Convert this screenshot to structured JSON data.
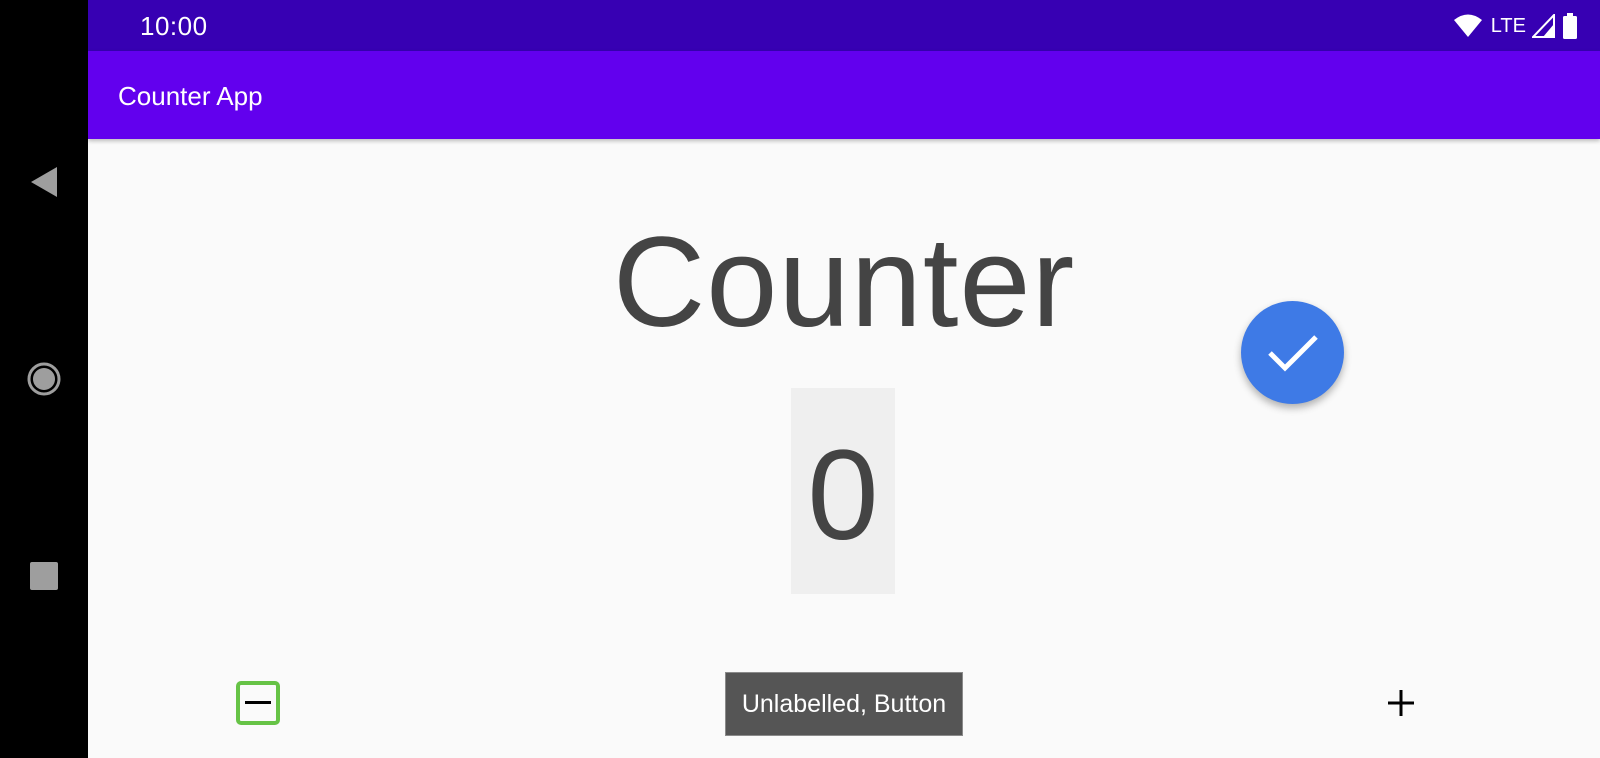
{
  "status_bar": {
    "time": "10:00",
    "network_label": "LTE",
    "icons": [
      "wifi-icon",
      "signal-icon",
      "battery-icon"
    ]
  },
  "app_bar": {
    "title": "Counter App"
  },
  "main": {
    "title": "Counter",
    "count_value": "0",
    "fab_icon": "check-icon",
    "decrement_icon": "minus-icon",
    "increment_icon": "plus-icon",
    "tooltip": "Unlabelled, Button"
  },
  "system_nav": {
    "buttons": [
      "back-icon",
      "home-icon",
      "recents-icon"
    ]
  },
  "colors": {
    "status_bar": "#3700b3",
    "app_bar": "#6200ee",
    "fab": "#3e7ae6",
    "focus_outline": "#66c346",
    "background": "#fafafa"
  }
}
